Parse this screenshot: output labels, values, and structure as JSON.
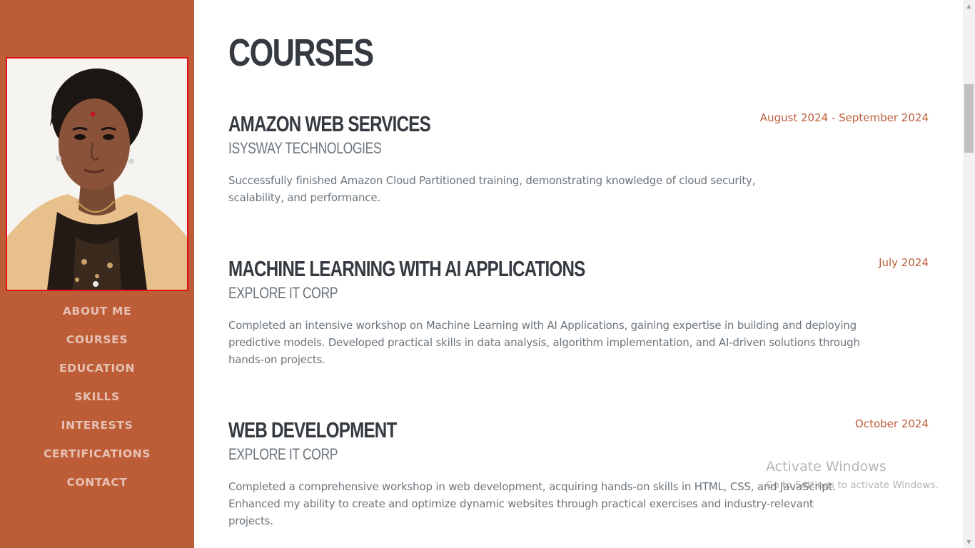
{
  "sidebar": {
    "nav": [
      "ABOUT ME",
      "COURSES",
      "EDUCATION",
      "SKILLS",
      "INTERESTS",
      "CERTIFICATIONS",
      "CONTACT"
    ]
  },
  "courses": {
    "title": "COURSES",
    "items": [
      {
        "title": "AMAZON WEB SERVICES",
        "org": "ISYSWAY TECHNOLOGIES",
        "date": "August 2024 - September 2024",
        "desc_lines": [
          "Successfully finished Amazon Cloud Partitioned training, demonstrating knowledge of cloud security,",
          "scalability, and performance."
        ]
      },
      {
        "title": "MACHINE LEARNING WITH AI APPLICATIONS",
        "org": "EXPLORE IT CORP",
        "date": "July 2024",
        "desc_lines": [
          "Completed an intensive workshop on Machine Learning with AI Applications, gaining expertise in building and deploying",
          "predictive models. Developed practical skills in data analysis, algorithm implementation, and AI-driven solutions through",
          "hands-on projects."
        ]
      },
      {
        "title": "WEB DEVELOPMENT",
        "org": "EXPLORE IT CORP",
        "date": "October 2024",
        "desc_lines": [
          "Completed a comprehensive workshop in web development, acquiring hands-on skills in HTML, CSS, and JavaScript.",
          "Enhanced my ability to create and optimize dynamic websites through practical exercises and industry-relevant",
          "projects."
        ]
      }
    ]
  },
  "watermark": {
    "title": "Activate Windows",
    "subtitle": "Go to Settings to activate Windows."
  },
  "colors": {
    "sidebar": "#bd5d38",
    "heading": "#343a40",
    "muted": "#6c757d",
    "accent": "#bd5d38",
    "photo_border": "#e0101a"
  },
  "icons": {
    "scroll_up": "scroll-up-arrow-icon",
    "scroll_down": "scroll-down-arrow-icon"
  }
}
